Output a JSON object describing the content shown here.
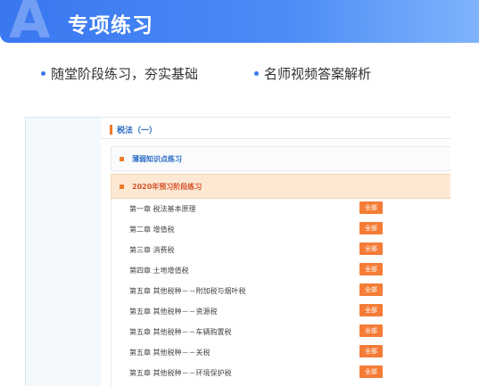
{
  "banner": {
    "letter": "A",
    "title": "专项练习"
  },
  "features": [
    "随堂阶段练习，夯实基础",
    "名师视频答案解析"
  ],
  "panel": {
    "section_title": "税法（一）",
    "groups": [
      "薄弱知识点练习",
      "2020年预习阶段练习"
    ],
    "button_label": "全部",
    "chapters": [
      "第一章  税法基本原理",
      "第二章  增值税",
      "第三章  消费税",
      "第四章  土地增值税",
      "第五章  其他税种－－附加税与烟叶税",
      "第五章  其他税种－－资源税",
      "第五章  其他税种－－车辆购置税",
      "第五章  其他税种－－关税",
      "第五章  其他税种－－环境保护税"
    ]
  },
  "colors": {
    "accent": "#3a77f0",
    "orange": "#f47c36",
    "link_blue": "#2b6cc4"
  }
}
